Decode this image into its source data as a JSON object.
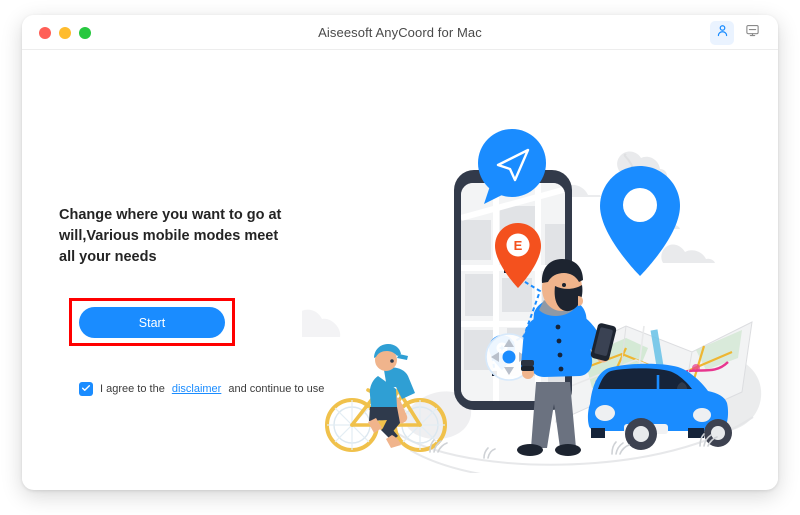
{
  "window": {
    "title": "Aiseesoft AnyCoord for Mac",
    "traffic_lights": [
      {
        "name": "close",
        "color": "#ff5f57"
      },
      {
        "name": "minimize",
        "color": "#febc2e"
      },
      {
        "name": "maximize",
        "color": "#28c840"
      }
    ],
    "actions": [
      {
        "name": "account-button",
        "icon": "user-icon"
      },
      {
        "name": "screen-button",
        "icon": "monitor-icon"
      }
    ]
  },
  "main": {
    "headline": "Change where you want to go at will,Various mobile modes meet all your needs",
    "start_label": "Start",
    "agree_prefix": "I agree to the",
    "disclaimer_label": "disclaimer",
    "agree_suffix": "and continue to use",
    "checkbox_checked": true,
    "highlight_color": "#ff0000"
  },
  "colors": {
    "accent": "#1a8cff",
    "pin_orange": "#f4511e",
    "text": "#242424",
    "background": "#ffffff"
  },
  "illustration": {
    "name": "location-spoofing-illustration",
    "elements": [
      "cloud",
      "smartphone",
      "map-screen",
      "navigation-bubble",
      "orange-destination-pin",
      "dashed-route",
      "start-marker",
      "dpad-control",
      "paper-map",
      "large-blue-pin",
      "man-with-phone",
      "blue-car",
      "cyclist",
      "grass"
    ],
    "pin_letter": "E"
  }
}
